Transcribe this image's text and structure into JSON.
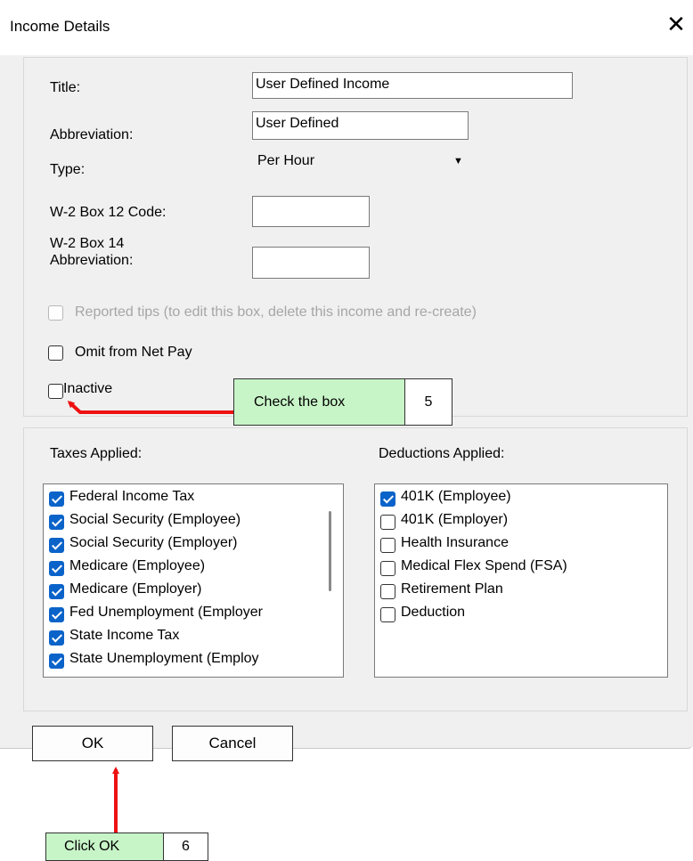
{
  "dialog": {
    "title": "Income Details",
    "close_icon": "close-icon"
  },
  "form": {
    "title_label": "Title:",
    "title_value": "User Defined Income",
    "abbreviation_label": "Abbreviation:",
    "abbreviation_value": "User Defined",
    "type_label": "Type:",
    "type_value": "Per Hour",
    "w2_box12_label": "W-2 Box 12 Code:",
    "w2_box12_value": "",
    "w2_box14_label_line1": "W-2 Box 14",
    "w2_box14_label_line2": "Abbreviation:",
    "w2_box14_value": ""
  },
  "checkboxes": {
    "reported_tips": {
      "label": "Reported tips (to edit this box, delete this income and re-create)",
      "checked": false,
      "disabled": true
    },
    "omit_net_pay": {
      "label": "Omit from Net Pay",
      "checked": false
    },
    "inactive": {
      "label": "Inactive",
      "checked": false
    }
  },
  "taxes": {
    "header": "Taxes Applied:",
    "items": [
      {
        "label": "Federal Income Tax",
        "checked": true
      },
      {
        "label": "Social Security (Employee)",
        "checked": true
      },
      {
        "label": "Social Security (Employer)",
        "checked": true
      },
      {
        "label": "Medicare (Employee)",
        "checked": true
      },
      {
        "label": "Medicare (Employer)",
        "checked": true
      },
      {
        "label": "Fed Unemployment (Employer",
        "checked": true
      },
      {
        "label": "State Income Tax",
        "checked": true
      },
      {
        "label": "State Unemployment (Employ",
        "checked": true
      }
    ]
  },
  "deductions": {
    "header": "Deductions Applied:",
    "items": [
      {
        "label": "401K (Employee)",
        "checked": true
      },
      {
        "label": "401K (Employer)",
        "checked": false
      },
      {
        "label": "Health Insurance",
        "checked": false
      },
      {
        "label": "Medical Flex Spend (FSA)",
        "checked": false
      },
      {
        "label": "Retirement Plan",
        "checked": false
      },
      {
        "label": "Deduction",
        "checked": false
      }
    ]
  },
  "buttons": {
    "ok": "OK",
    "cancel": "Cancel"
  },
  "annotations": {
    "step5_text": "Check the box",
    "step5_number": "5",
    "step6_text": "Click OK",
    "step6_number": "6",
    "arrow_color": "#ee1111",
    "callout_color": "#c8f5c8"
  },
  "colors": {
    "check_blue": "#0a63c9",
    "dialog_bg": "#f0f0f0"
  }
}
